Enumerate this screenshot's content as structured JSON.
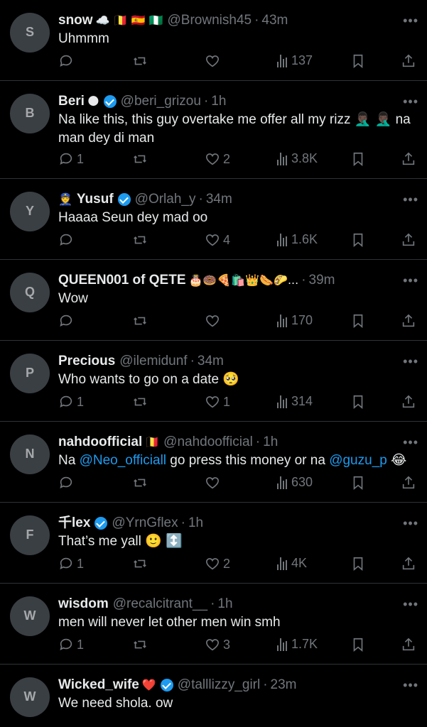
{
  "tweets": [
    {
      "name": "snow",
      "emoji": "☁️  🇧🇪 🇪🇸 🇳🇬",
      "verified": false,
      "handle": "@Brownish45",
      "time": "43m",
      "text": "Uhmmm",
      "replies": "",
      "likes": "",
      "views": "137"
    },
    {
      "name": "Beri",
      "emoji": "🌑",
      "verified": true,
      "handle": "@beri_grizou",
      "time": "1h",
      "text": "Na like this, this guy overtake me offer all my rizz 🤦🏿‍♂️ 🤦🏿‍♂️ na man dey di man",
      "replies": "1",
      "likes": "2",
      "views": "3.8K"
    },
    {
      "name": "Yusuf",
      "emoji": "👮",
      "verified": true,
      "handle": "@Orlah_y",
      "time": "34m",
      "text": "Haaaa Seun dey mad oo",
      "replies": "",
      "likes": "4",
      "views": "1.6K"
    },
    {
      "name": "QUEEN001 of QETE",
      "emoji": "🎂🍩🍕🛍️👑🌭🌮...",
      "verified": false,
      "handle": "",
      "time": "39m",
      "text": "Wow",
      "replies": "",
      "likes": "",
      "views": "170"
    },
    {
      "name": "Precious",
      "emoji": "",
      "verified": false,
      "handle": "@ilemidunf",
      "time": "34m",
      "text": "Who wants to go on a date 🥺",
      "replies": "1",
      "likes": "1",
      "views": "314"
    },
    {
      "name": "nahdoofficial",
      "emoji": "🇧🇪",
      "verified": false,
      "handle": "@nahdoofficial",
      "time": "1h",
      "text_parts": [
        "Na ",
        "@Neo_officiall",
        " go press this money or na ",
        "@guzu_p",
        " 😂"
      ],
      "replies": "",
      "likes": "",
      "views": "630"
    },
    {
      "name": "千lex",
      "emoji": "",
      "verified": true,
      "handle": "@YrnGflex",
      "time": "1h",
      "text": "That’s me yall 🙂 ↕️",
      "replies": "1",
      "likes": "2",
      "views": "4K"
    },
    {
      "name": "wisdom",
      "emoji": "",
      "verified": false,
      "handle": "@recalcitrant__",
      "time": "1h",
      "text": "men will never let other men win smh",
      "replies": "1",
      "likes": "3",
      "views": "1.7K"
    },
    {
      "name": "Wicked_wife",
      "emoji": "❤️",
      "verified": true,
      "handle": "@talllizzy_girl",
      "time": "23m",
      "text": "We need shola. ow",
      "replies": "",
      "likes": "",
      "views": ""
    }
  ],
  "more_label": "•••",
  "colors": {
    "background": "#000000",
    "text": "#e7e9ea",
    "muted": "#71767b",
    "accent": "#1d9bf0",
    "divider": "#2f3336"
  }
}
